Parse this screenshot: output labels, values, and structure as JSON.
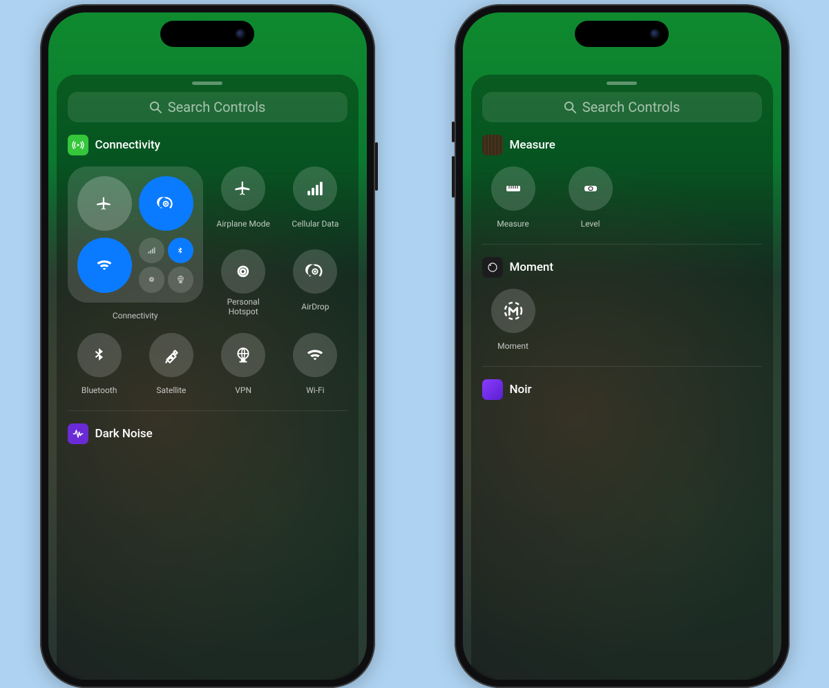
{
  "search": {
    "placeholder": "Search Controls"
  },
  "left": {
    "sections": [
      {
        "icon": "antenna-icon",
        "title": "Connectivity",
        "cluster_label": "Connectivity",
        "tiles": [
          {
            "icon": "airplane-icon",
            "label": "Airplane Mode"
          },
          {
            "icon": "cellular-bars-icon",
            "label": "Cellular Data"
          },
          {
            "icon": "hotspot-icon",
            "label": "Personal\nHotspot"
          },
          {
            "icon": "airdrop-icon",
            "label": "AirDrop"
          },
          {
            "icon": "bluetooth-icon",
            "label": "Bluetooth"
          },
          {
            "icon": "satellite-icon",
            "label": "Satellite"
          },
          {
            "icon": "vpn-globe-icon",
            "label": "VPN"
          },
          {
            "icon": "wifi-icon",
            "label": "Wi-Fi"
          }
        ]
      },
      {
        "icon": "darknoise-icon",
        "title": "Dark Noise"
      }
    ]
  },
  "right": {
    "sections": [
      {
        "icon": "measure-app-icon",
        "title": "Measure",
        "tiles": [
          {
            "icon": "ruler-icon",
            "label": "Measure"
          },
          {
            "icon": "level-icon",
            "label": "Level"
          }
        ]
      },
      {
        "icon": "moment-app-icon",
        "title": "Moment",
        "tiles": [
          {
            "icon": "moment-m-icon",
            "label": "Moment"
          }
        ]
      },
      {
        "icon": "noir-app-icon",
        "title": "Noir"
      }
    ]
  }
}
